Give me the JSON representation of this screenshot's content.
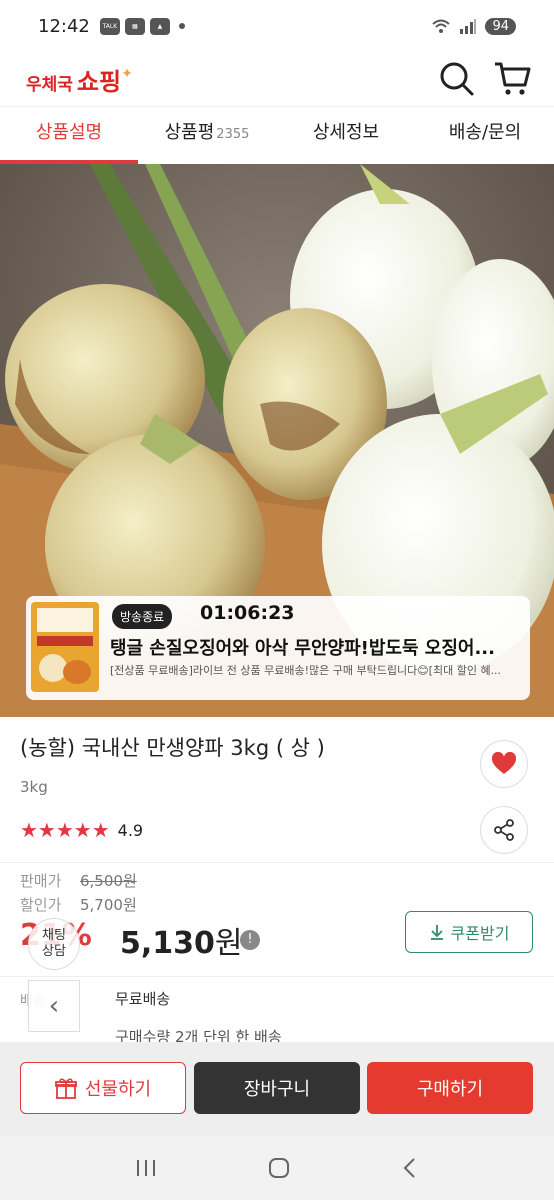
{
  "status_bar": {
    "time": "12:42",
    "battery": "94",
    "notif_talk": "TALK"
  },
  "header": {
    "logo_small": "우체국",
    "logo_big": "쇼핑"
  },
  "tabs": [
    {
      "label": "상품설명",
      "active": true
    },
    {
      "label": "상품평",
      "count": "2355"
    },
    {
      "label": "상세정보"
    },
    {
      "label": "배송/문의"
    }
  ],
  "live": {
    "badge": "방송종료",
    "timer": "01:06:23",
    "title": "탱글 손질오징어와 아삭 무안양파!밥도둑 오징어...",
    "desc": "[전상품 무료배송]라이브 전 상품 무료배송!많은 구매 부탁드립니다😊[최대 할인 혜..."
  },
  "product": {
    "name": "(농할) 국내산 만생양파 3kg ( 상 )",
    "option": "3kg",
    "stars": "★★★★★",
    "rating": "4.9"
  },
  "price": {
    "sale_label": "판매가",
    "sale_value": "6,500원",
    "discount_label": "할인가",
    "discount_value": "5,700원",
    "discount_rate": "21%",
    "final_value": "5,130",
    "final_unit": "원",
    "coupon_label": "쿠폰받기"
  },
  "chat": {
    "line1": "채팅",
    "line2": "상담"
  },
  "shipping": {
    "label": "배송",
    "value": "무료배송",
    "note": "구매수량 2개 단위 한 배송"
  },
  "actions": {
    "gift": "선물하기",
    "cart": "장바구니",
    "buy": "구매하기"
  },
  "colors": {
    "accent": "#e03a3a",
    "coupon": "#2e8b6e",
    "dark_button": "#333333"
  }
}
